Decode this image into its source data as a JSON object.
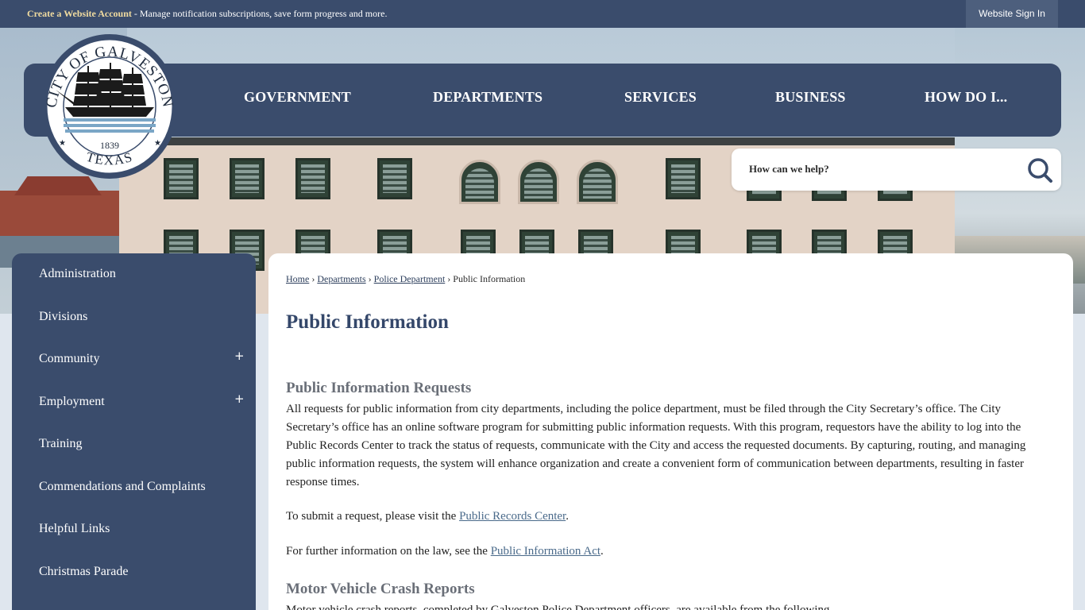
{
  "topbar": {
    "create_account_link": "Create a Website Account",
    "notice_text": " - Manage notification subscriptions, save form progress and more.",
    "signin_label": "Website Sign In"
  },
  "seal": {
    "top_text": "CITY OF GALVESTON",
    "year": "1839",
    "bottom_text": "TEXAS"
  },
  "nav": {
    "items": [
      {
        "label": "GOVERNMENT"
      },
      {
        "label": "DEPARTMENTS"
      },
      {
        "label": "SERVICES"
      },
      {
        "label": "BUSINESS"
      },
      {
        "label": "HOW DO I..."
      }
    ]
  },
  "search": {
    "placeholder": "How can we help?",
    "icon": "search-icon"
  },
  "sidebar": {
    "items": [
      {
        "label": "Administration",
        "expandable": false
      },
      {
        "label": "Divisions",
        "expandable": false
      },
      {
        "label": "Community",
        "expandable": true,
        "toggle": "+"
      },
      {
        "label": "Employment",
        "expandable": true,
        "toggle": "+"
      },
      {
        "label": "Training",
        "expandable": false
      },
      {
        "label": "Commendations and Complaints",
        "expandable": false
      },
      {
        "label": "Helpful Links",
        "expandable": false
      },
      {
        "label": "Christmas Parade",
        "expandable": false
      }
    ]
  },
  "breadcrumb": {
    "separator": "›",
    "items": [
      "Home",
      "Departments",
      "Police Department"
    ],
    "current": "Public Information"
  },
  "content": {
    "title": "Public Information",
    "section1_heading": "Public Information Requests",
    "section1_text": "All requests for public information from city departments, including the police department, must be filed through the City Secretary’s office. The City Secretary’s office has an online software program for submitting public information requests. With this program, requestors have the ability to log into the Public Records Center to track the status of requests, communicate with the City and access the requested documents. By capturing, routing, and managing public information requests, the system will enhance organization and create a convenient form of communication between departments, resulting in faster response times.",
    "submit_text": "To submit a request, please visit the ",
    "submit_link": "Public Records Center",
    "submit_end": ".",
    "law_text": "For further information on the law, see the ",
    "law_link": "Public Information Act",
    "law_end": ".",
    "section2_heading": "Motor Vehicle Crash Reports",
    "section2_text": "Motor vehicle crash reports, completed by Galveston Police Department officers, are available from the following"
  },
  "colors": {
    "navy": "#3a4c6c",
    "heading_gray": "#6a6f78",
    "title_navy": "#34476a",
    "notice_gold": "#f1dca0"
  }
}
